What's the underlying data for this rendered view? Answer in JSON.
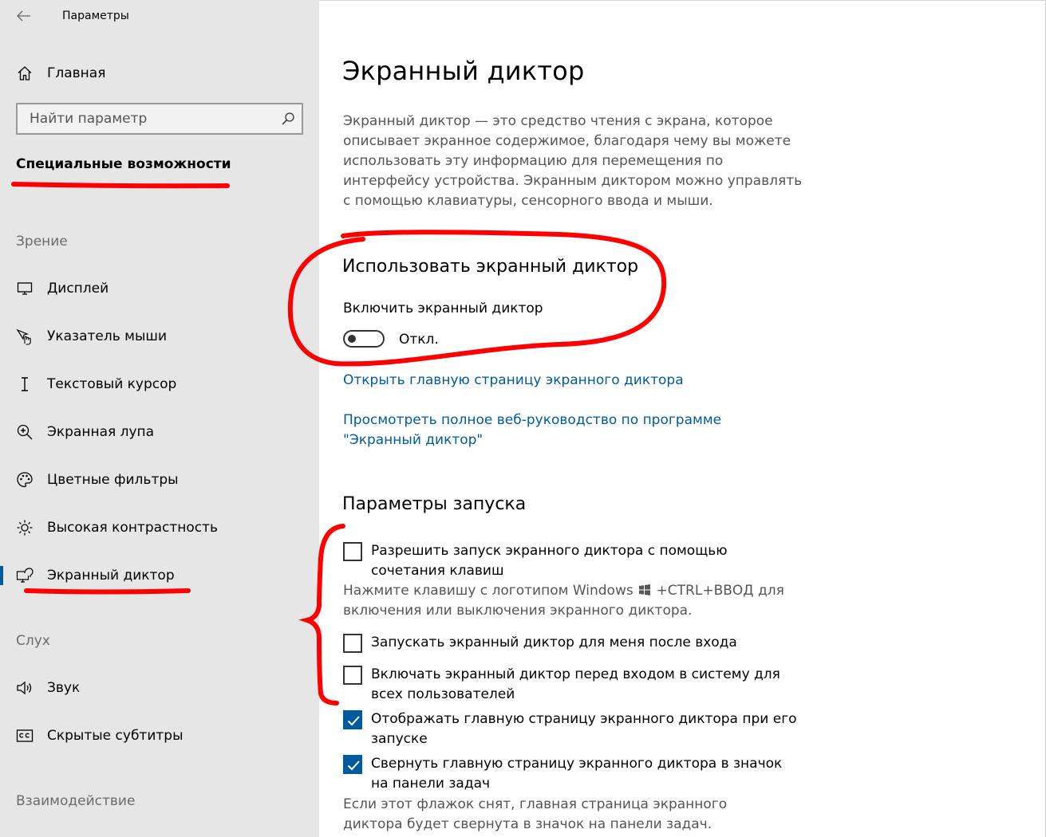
{
  "window": {
    "title": "Параметры"
  },
  "sidebar": {
    "home_label": "Главная",
    "search_placeholder": "Найти параметр",
    "section_title": "Специальные возможности",
    "groups": {
      "vision": "Зрение",
      "hearing": "Слух",
      "interaction": "Взаимодействие"
    },
    "items": [
      {
        "label": "Дисплей",
        "icon": "display-icon"
      },
      {
        "label": "Указатель мыши",
        "icon": "mouse-pointer-icon"
      },
      {
        "label": "Текстовый курсор",
        "icon": "text-cursor-icon"
      },
      {
        "label": "Экранная лупа",
        "icon": "magnifier-icon"
      },
      {
        "label": "Цветные фильтры",
        "icon": "color-palette-icon"
      },
      {
        "label": "Высокая контрастность",
        "icon": "sun-icon"
      },
      {
        "label": "Экранный диктор",
        "icon": "narrator-icon",
        "selected": true
      },
      {
        "label": "Звук",
        "icon": "speaker-icon"
      },
      {
        "label": "Скрытые субтитры",
        "icon": "closed-captions-icon"
      }
    ]
  },
  "main": {
    "title": "Экранный диктор",
    "description": "Экранный диктор — это средство чтения с экрана, которое описывает экранное содержимое, благодаря чему вы можете использовать эту информацию для перемещения по интерфейсу устройства. Экранным диктором можно управлять с помощью клавиатуры, сенсорного ввода и мыши.",
    "use_section": {
      "heading": "Использовать экранный диктор",
      "toggle_caption": "Включить экранный диктор",
      "toggle_state": "Откл.",
      "toggle_on": false
    },
    "links": {
      "home_page": "Открыть главную страницу экранного диктора",
      "web_guide": "Просмотреть полное веб-руководство по программе \"Экранный диктор\""
    },
    "startup": {
      "heading": "Параметры запуска",
      "options": [
        {
          "label": "Разрешить запуск экранного диктора с помощью сочетания клавиш",
          "checked": false
        },
        {
          "label": "Запускать экранный диктор для меня после входа",
          "checked": false
        },
        {
          "label": "Включать экранный диктор перед входом в систему для всех пользователей",
          "checked": false
        },
        {
          "label": "Отображать главную страницу экранного диктора при его запуске",
          "checked": true
        },
        {
          "label": "Свернуть главную страницу экранного диктора в значок на панели задач",
          "checked": true
        }
      ],
      "shortcut_hint_before": "Нажмите клавишу с логотипом Windows",
      "shortcut_hint_after": "+CTRL+ВВОД для включения или выключения экранного диктора.",
      "minimize_hint": "Если этот флажок снят, главная страница экранного диктора будет свернута в значок на панели задач."
    }
  },
  "colors": {
    "accent": "#005a9e",
    "annotation": "#ff0000",
    "sidebar_bg": "#e6e6e6"
  }
}
